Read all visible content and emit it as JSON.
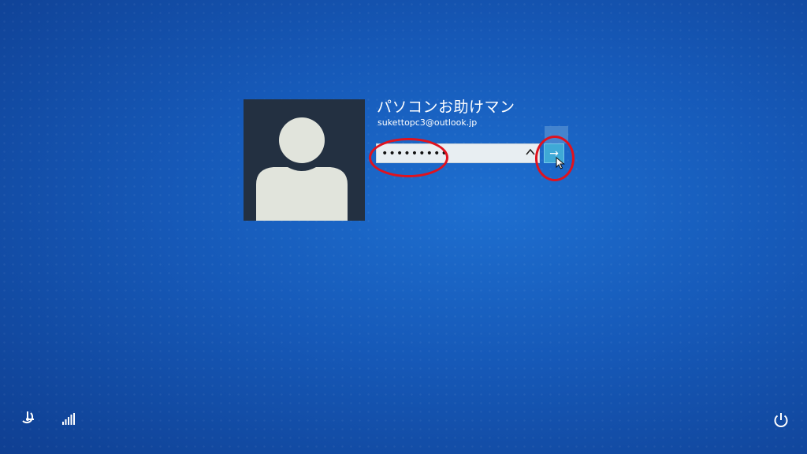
{
  "user": {
    "name": "パソコンお助けマン",
    "email": "sukettopc3@outlook.jp"
  },
  "password": {
    "value": "•••••••••",
    "reveal_icon": "eye-reveal-icon",
    "submit_icon": "arrow-right-icon",
    "submit_glyph": "→"
  },
  "icons": {
    "ease_of_access": "ease-of-access-icon",
    "network": "network-signal-icon",
    "power": "power-icon"
  },
  "colors": {
    "background": "#1659b8",
    "avatar_bg": "#233041",
    "avatar_fg": "#e1e4dc",
    "submit_bg": "#3fa9d6",
    "annotation": "#e0121e"
  }
}
